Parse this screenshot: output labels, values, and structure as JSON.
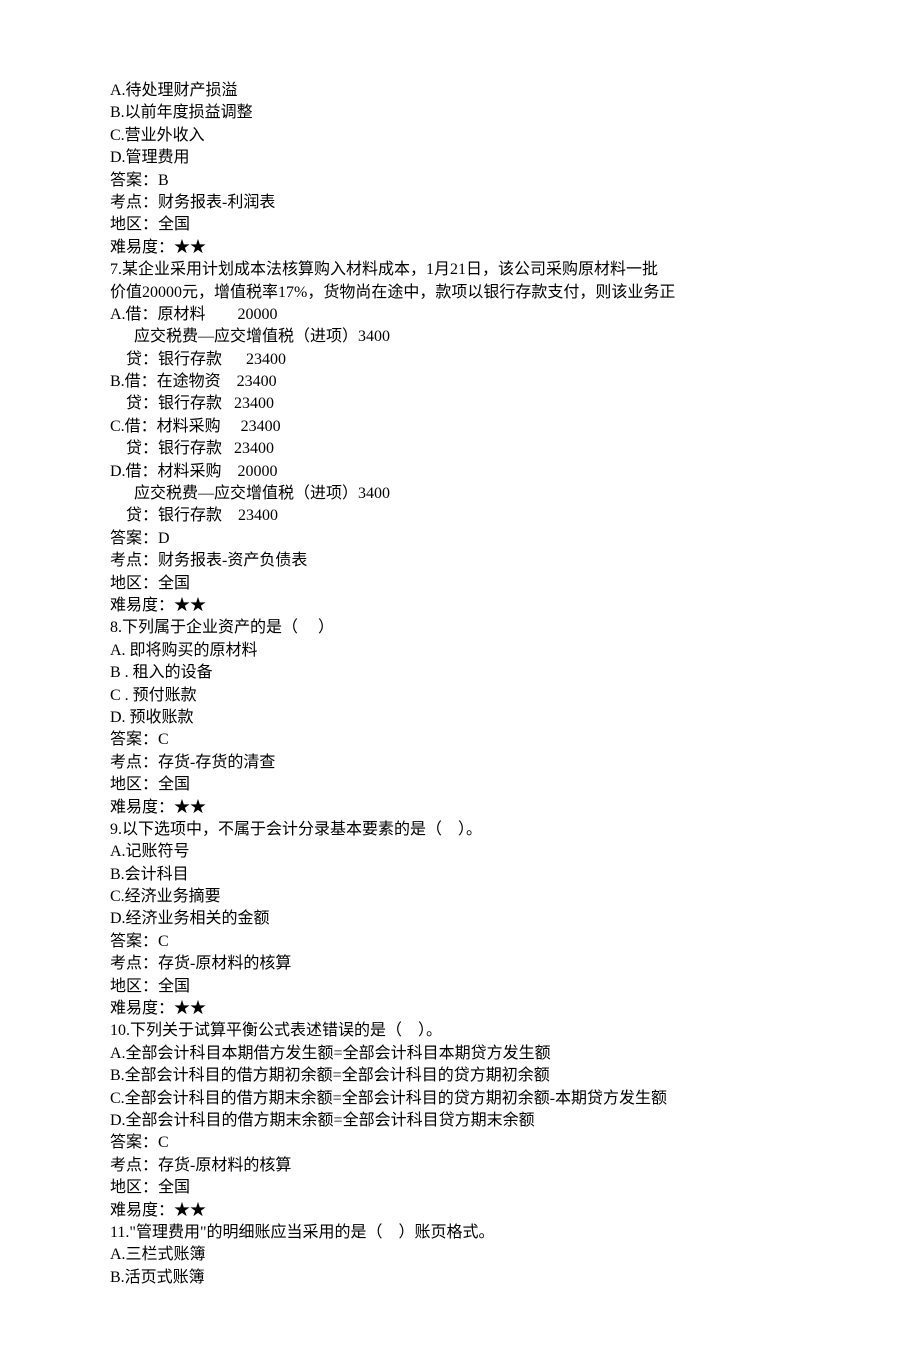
{
  "lines": [
    "A.待处理财产损溢",
    "B.以前年度损益调整",
    "C.营业外收入",
    "D.管理费用",
    "答案：B",
    "考点：财务报表-利润表",
    "地区：全国",
    "难易度：★★",
    "7.某企业采用计划成本法核算购入材料成本，1月21日，该公司采购原材料一批",
    "价值20000元，增值税率17%，货物尚在途中，款项以银行存款支付，则该业务正",
    "A.借：原材料        20000",
    "      应交税费—应交增值税（进项）3400",
    "    贷：银行存款      23400",
    "B.借：在途物资    23400",
    "    贷：银行存款   23400",
    "C.借：材料采购     23400",
    "    贷：银行存款   23400",
    "D.借：材料采购    20000",
    "      应交税费—应交增值税（进项）3400",
    "    贷：银行存款    23400",
    "答案：D",
    "考点：财务报表-资产负债表",
    "地区：全国",
    "难易度：★★",
    "8.下列属于企业资产的是（     ）",
    "A. 即将购买的原材料",
    "B . 租入的设备",
    "C . 预付账款",
    "D. 预收账款",
    "答案：C",
    "考点：存货-存货的清查",
    "地区：全国",
    "难易度：★★",
    "9.以下选项中，不属于会计分录基本要素的是（    ）。",
    "A.记账符号",
    "B.会计科目",
    "C.经济业务摘要",
    "D.经济业务相关的金额",
    "答案：C",
    "考点：存货-原材料的核算",
    "地区：全国",
    "难易度：★★",
    "10.下列关于试算平衡公式表述错误的是（    ）。",
    "A.全部会计科目本期借方发生额=全部会计科目本期贷方发生额",
    "B.全部会计科目的借方期初余额=全部会计科目的贷方期初余额",
    "C.全部会计科目的借方期末余额=全部会计科目的贷方期初余额-本期贷方发生额",
    "D.全部会计科目的借方期末余额=全部会计科目贷方期末余额",
    "答案：C",
    "考点：存货-原材料的核算",
    "地区：全国",
    "难易度：★★",
    "11.\"管理费用\"的明细账应当采用的是（    ）账页格式。",
    "A.三栏式账簿",
    "B.活页式账簿"
  ]
}
